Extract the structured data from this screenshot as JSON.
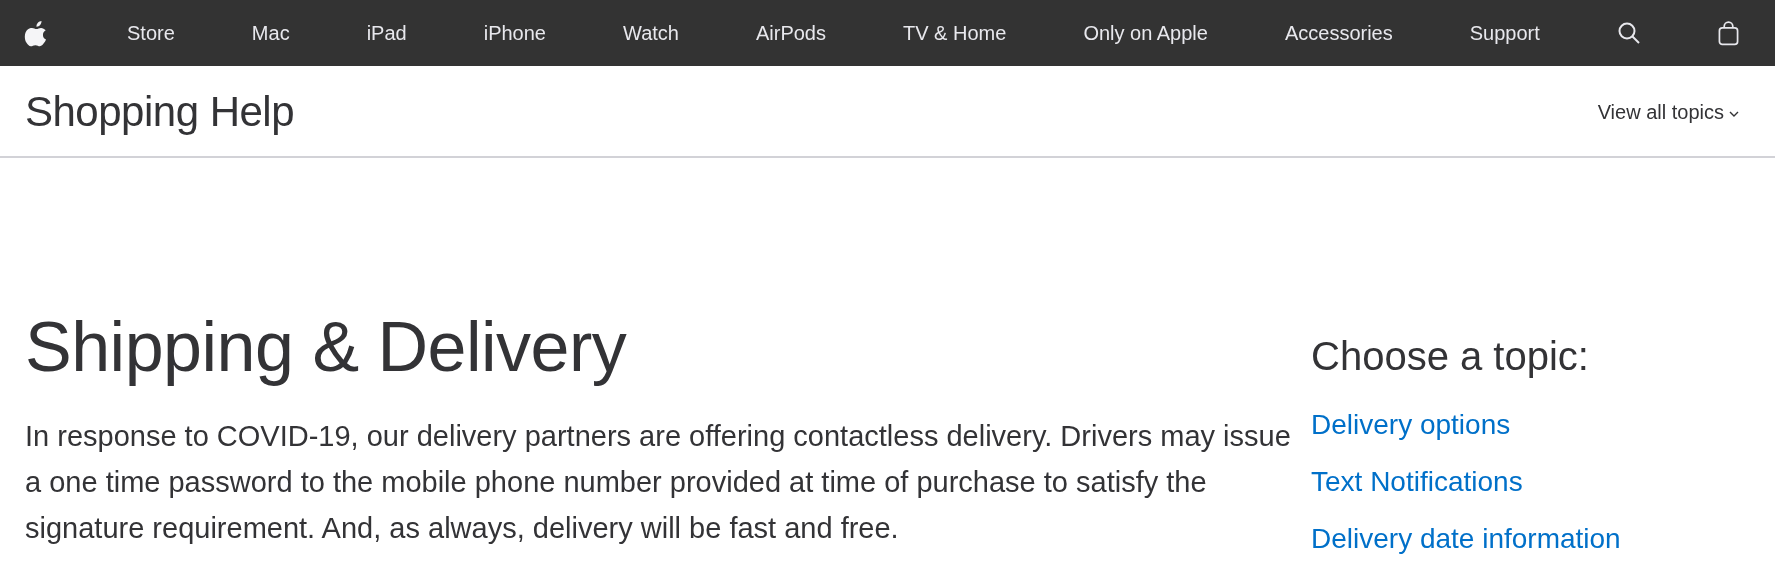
{
  "global_nav": {
    "items": [
      {
        "label": "Store"
      },
      {
        "label": "Mac"
      },
      {
        "label": "iPad"
      },
      {
        "label": "iPhone"
      },
      {
        "label": "Watch"
      },
      {
        "label": "AirPods"
      },
      {
        "label": "TV & Home"
      },
      {
        "label": "Only on Apple"
      },
      {
        "label": "Accessories"
      },
      {
        "label": "Support"
      }
    ]
  },
  "subheader": {
    "title": "Shopping Help",
    "menu_link": "View all topics"
  },
  "article": {
    "title": "Shipping & Delivery",
    "intro": "In response to COVID-19, our delivery partners are offering contactless delivery. Drivers may issue a one time password to the mobile phone number provided at time of purchase to satisfy the signature requirement. And, as always, delivery will be fast and free."
  },
  "topics": {
    "heading": "Choose a topic:",
    "links": [
      {
        "label": "Delivery options"
      },
      {
        "label": "Text Notifications"
      },
      {
        "label": "Delivery date information"
      }
    ]
  }
}
